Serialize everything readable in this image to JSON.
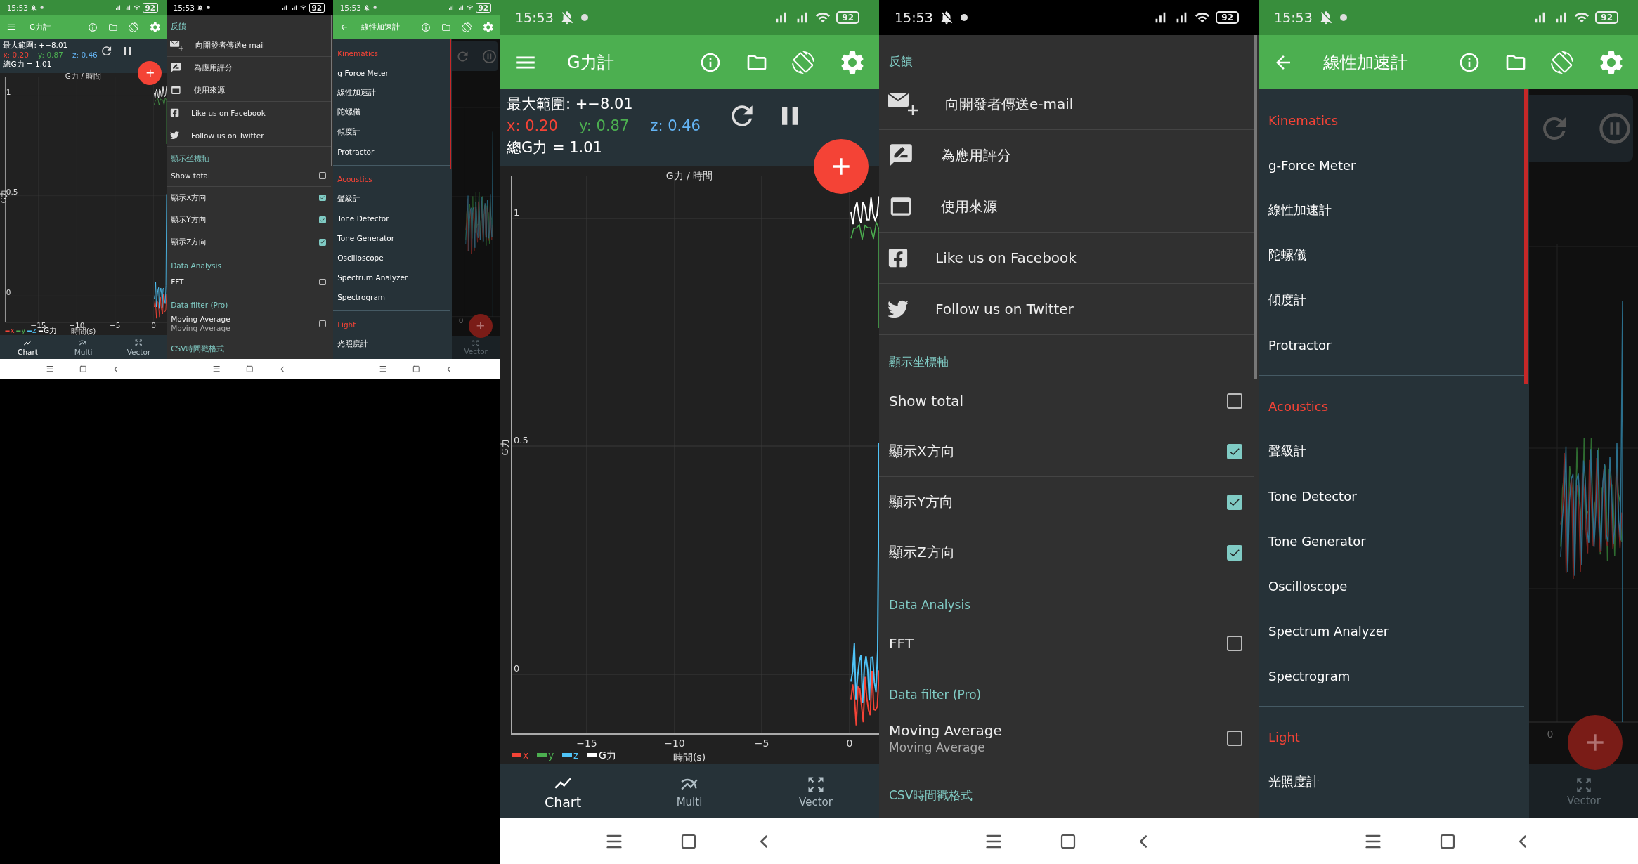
{
  "thumbnails": [
    {
      "kind": "chart",
      "status": {
        "time": "15:53",
        "battery": "92"
      },
      "app_bar": {
        "back_button": false,
        "title": "G力計"
      },
      "info": {
        "range": "最大範圍: +−8.01",
        "readings": [
          {
            "label": "x: 0.20",
            "color": "#f44336"
          },
          {
            "label": "y: 0.87",
            "color": "#4caf50"
          },
          {
            "label": "z: 0.46",
            "color": "#64b5f6"
          }
        ],
        "total": "總G力 = 1.01"
      },
      "chart": {
        "title": "G力 / 時間",
        "ylabel": "G力",
        "yticks": [
          "1",
          "0.5",
          "0"
        ],
        "xticks": [
          "−15",
          "−10",
          "−5",
          "0"
        ],
        "xlabel": "時間(s)",
        "legend": [
          {
            "label": "x",
            "color": "#f44336"
          },
          {
            "label": "y",
            "color": "#4caf50"
          },
          {
            "label": "z",
            "color": "#4fc3f7"
          },
          {
            "label": "G力",
            "color": "#ffffff"
          }
        ]
      },
      "bottom_nav": [
        {
          "label": "Chart",
          "selected": true
        },
        {
          "label": "Multi",
          "selected": false
        },
        {
          "label": "Vector",
          "selected": false
        }
      ]
    },
    {
      "kind": "settings_drawer",
      "status": {
        "time": "15:53",
        "battery": "92"
      },
      "sections": [
        {
          "header": "反饋",
          "items": [
            {
              "kind": "link",
              "label": "向開發者傳送e-mail"
            },
            {
              "kind": "link",
              "label": "為應用評分"
            },
            {
              "kind": "link",
              "label": "使用來源"
            },
            {
              "kind": "link",
              "label": "Like us on Facebook"
            },
            {
              "kind": "link",
              "label": "Follow us on Twitter"
            }
          ]
        },
        {
          "header": "顯示坐標軸",
          "items": [
            {
              "kind": "check",
              "label": "Show total",
              "checked": false
            },
            {
              "kind": "check",
              "label": "顯示X方向",
              "checked": true
            },
            {
              "kind": "check",
              "label": "顯示Y方向",
              "checked": true
            },
            {
              "kind": "check",
              "label": "顯示Z方向",
              "checked": true
            }
          ]
        },
        {
          "header": "Data Analysis",
          "items": [
            {
              "kind": "check",
              "label": "FFT",
              "checked": false
            }
          ]
        },
        {
          "header": "Data filter (Pro)",
          "items": [
            {
              "kind": "check",
              "label": "Moving Average",
              "sublabel": "Moving Average",
              "checked": false
            }
          ]
        },
        {
          "header": "CSV時間戳格式"
        }
      ]
    },
    {
      "kind": "nav_drawer",
      "status": {
        "time": "15:53",
        "battery": "92"
      },
      "app_bar": {
        "back_button": true,
        "title": "線性加速計"
      },
      "sections": [
        {
          "header": "Kinematics",
          "items": [
            "g-Force Meter",
            "線性加速計",
            "陀螺儀",
            "傾度計",
            "Protractor"
          ]
        },
        {
          "header": "Acoustics",
          "items": [
            "聲級計",
            "Tone Detector",
            "Tone Generator",
            "Oscilloscope",
            "Spectrum Analyzer",
            "Spectrogram"
          ]
        },
        {
          "header": "Light",
          "items": [
            "光照度計"
          ]
        }
      ],
      "background": {
        "x_tick": "0",
        "nav_label": "Vector"
      }
    }
  ],
  "screens": [
    {
      "kind": "chart",
      "status": {
        "time": "15:53",
        "battery": "92"
      },
      "app_bar": {
        "back_button": false,
        "title": "G力計"
      },
      "info": {
        "range": "最大範圍: +−8.01",
        "readings": [
          {
            "label": "x: 0.20",
            "color": "#f44336"
          },
          {
            "label": "y: 0.87",
            "color": "#4caf50"
          },
          {
            "label": "z: 0.46",
            "color": "#64b5f6"
          }
        ],
        "total": "總G力 = 1.01"
      },
      "chart": {
        "title": "G力 / 時間",
        "ylabel": "G力",
        "yticks": [
          "1",
          "0.5",
          "0"
        ],
        "xticks": [
          "−15",
          "−10",
          "−5",
          "0"
        ],
        "xlabel": "時間(s)",
        "legend": [
          {
            "label": "x",
            "color": "#f44336"
          },
          {
            "label": "y",
            "color": "#4caf50"
          },
          {
            "label": "z",
            "color": "#4fc3f7"
          },
          {
            "label": "G力",
            "color": "#ffffff"
          }
        ]
      },
      "bottom_nav": [
        {
          "label": "Chart",
          "selected": true
        },
        {
          "label": "Multi",
          "selected": false
        },
        {
          "label": "Vector",
          "selected": false
        }
      ]
    },
    {
      "kind": "settings_drawer",
      "status": {
        "time": "15:53",
        "battery": "92"
      },
      "sections": [
        {
          "header": "反饋",
          "items": [
            {
              "kind": "link",
              "label": "向開發者傳送e-mail"
            },
            {
              "kind": "link",
              "label": "為應用評分"
            },
            {
              "kind": "link",
              "label": "使用來源"
            },
            {
              "kind": "link",
              "label": "Like us on Facebook"
            },
            {
              "kind": "link",
              "label": "Follow us on Twitter"
            }
          ]
        },
        {
          "header": "顯示坐標軸",
          "items": [
            {
              "kind": "check",
              "label": "Show total",
              "checked": false
            },
            {
              "kind": "check",
              "label": "顯示X方向",
              "checked": true
            },
            {
              "kind": "check",
              "label": "顯示Y方向",
              "checked": true
            },
            {
              "kind": "check",
              "label": "顯示Z方向",
              "checked": true
            }
          ]
        },
        {
          "header": "Data Analysis",
          "items": [
            {
              "kind": "check",
              "label": "FFT",
              "checked": false
            }
          ]
        },
        {
          "header": "Data filter (Pro)",
          "items": [
            {
              "kind": "check",
              "label": "Moving Average",
              "sublabel": "Moving Average",
              "checked": false
            }
          ]
        },
        {
          "header": "CSV時間戳格式"
        }
      ]
    },
    {
      "kind": "nav_drawer",
      "status": {
        "time": "15:53",
        "battery": "92"
      },
      "app_bar": {
        "back_button": true,
        "title": "線性加速計"
      },
      "sections": [
        {
          "header": "Kinematics",
          "items": [
            "g-Force Meter",
            "線性加速計",
            "陀螺儀",
            "傾度計",
            "Protractor"
          ]
        },
        {
          "header": "Acoustics",
          "items": [
            "聲級計",
            "Tone Detector",
            "Tone Generator",
            "Oscilloscope",
            "Spectrum Analyzer",
            "Spectrogram"
          ]
        },
        {
          "header": "Light",
          "items": [
            "光照度計"
          ]
        }
      ],
      "background": {
        "x_tick": "0",
        "nav_label": "Vector"
      }
    }
  ]
}
